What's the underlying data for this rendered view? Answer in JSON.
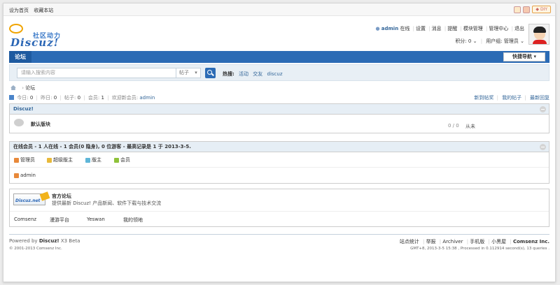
{
  "topbar": {
    "set_home": "设为首页",
    "bookmark": "收藏本站",
    "diy": "DIY"
  },
  "header": {
    "logo_cn": "社区动力",
    "logo_en": "Discuz!",
    "username": "admin",
    "status": "在线",
    "menu": [
      "设置",
      "消息",
      "提醒",
      "模块管理",
      "管理中心",
      "退出"
    ],
    "credits": "积分: 0",
    "usergroup": "用户组: 管理员"
  },
  "nav": {
    "tab": "论坛",
    "quick_nav": "快捷导航"
  },
  "search": {
    "placeholder": "请输入搜索内容",
    "type": "帖子",
    "hot_label": "热搜:",
    "hot_terms": [
      "活动",
      "交友",
      "discuz"
    ]
  },
  "breadcrumb": {
    "current": "论坛"
  },
  "stats": {
    "today_label": "今日:",
    "today_value": "0",
    "yesterday_label": "昨日:",
    "yesterday_value": "0",
    "posts_label": "帖子:",
    "posts_value": "0",
    "members_label": "会员:",
    "members_value": "1",
    "newest_label": "欢迎新会员:",
    "newest_value": "admin",
    "links": [
      "新到帖奖",
      "我的帖子",
      "最新回复"
    ]
  },
  "category": {
    "title": "Discuz!",
    "forum_name": "默认版块",
    "forum_counts": "0 / 0",
    "forum_last": "从未"
  },
  "online": {
    "title": "在线会员 - 1 人在线 - 1 会员(0 隐身), 0 位游客 - 最高记录是 1 于 2013-3-5.",
    "legend": [
      "管理员",
      "超级版主",
      "版主",
      "会员"
    ],
    "legend_colors": [
      "#e8893a",
      "#e8b93a",
      "#5fb6d8",
      "#8fc23a"
    ],
    "users": [
      "admin"
    ]
  },
  "official": {
    "logo_text": "Discuz.net",
    "title": "官方论坛",
    "desc": "提供最新 Discuz! 产品新闻、软件下载与技术交流",
    "links": [
      "Comsenz",
      "漫游平台",
      "Yeswan",
      "我的领地"
    ]
  },
  "footer": {
    "powered_prefix": "Powered by",
    "powered_product": "Discuz!",
    "powered_version": "X3 Beta",
    "copyright": "© 2001-2013 Comsenz Inc.",
    "links": [
      "站点统计",
      "举报",
      "Archiver",
      "手机版",
      "小黑屋"
    ],
    "company": "Comsenz Inc.",
    "gmt": "GMT+8, 2013-3-5 15:38 , Processed in 0.112914 second(s), 13 queries ."
  }
}
